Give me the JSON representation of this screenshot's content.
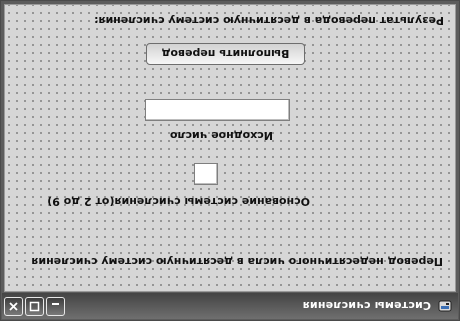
{
  "window": {
    "title": "Системы счисления",
    "icon": "app-icon",
    "controls": [
      "minimize-icon",
      "maximize-icon",
      "close-icon"
    ]
  },
  "form": {
    "heading": "Перевод недесятичного числа в десятичную систему счисления",
    "base_label": "Основание системы счисления(от 2 до 9)",
    "base_value": "",
    "number_label": "Исходное число",
    "number_value": "",
    "convert_button": "Выполнить перевод",
    "result_label": "Результат перевода в десятичную систему счисления:"
  },
  "colors": {
    "titlebar": "#444444",
    "client_background": "#d6d6d6"
  }
}
